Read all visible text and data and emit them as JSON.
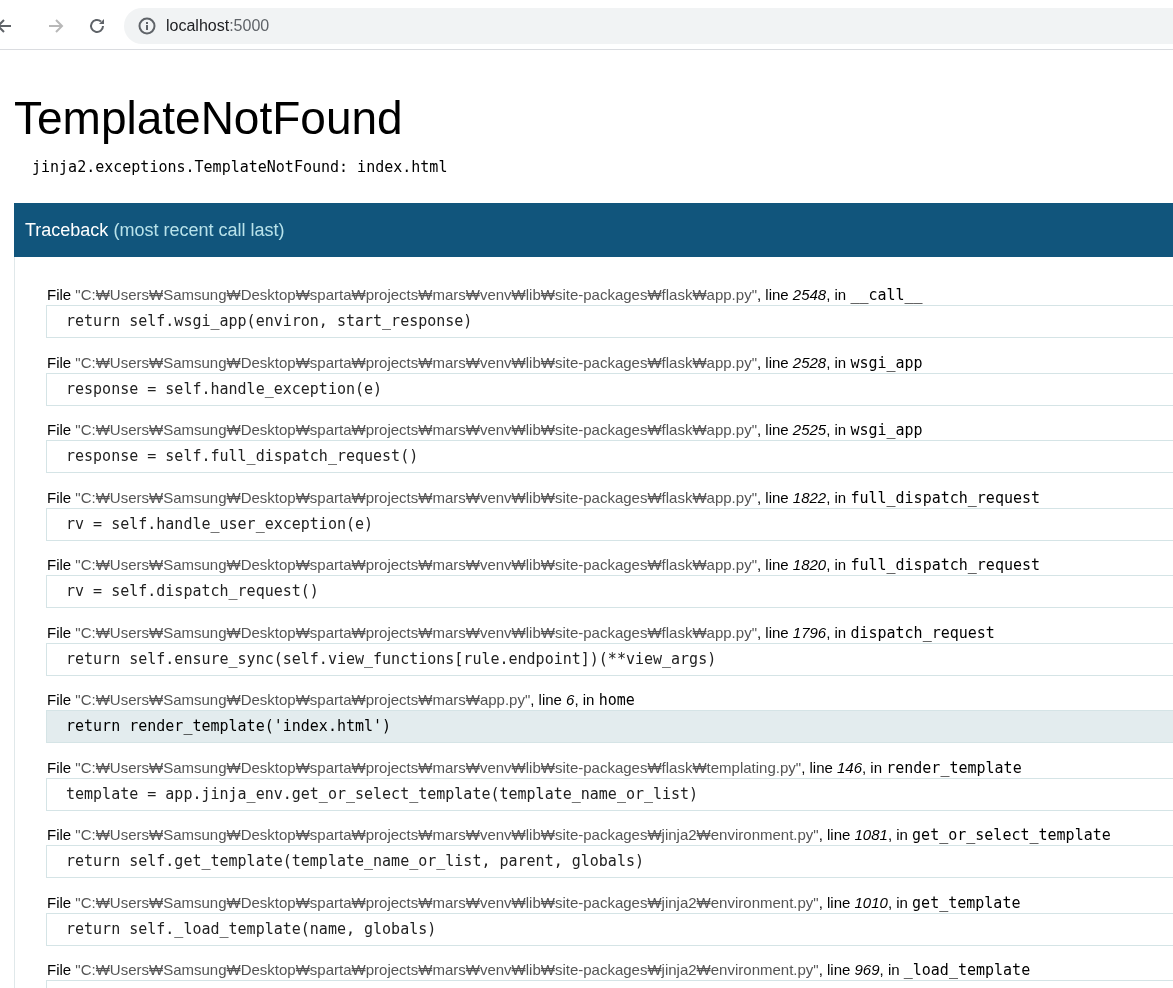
{
  "browser": {
    "url_host": "localhost",
    "url_port": ":5000"
  },
  "title": "TemplateNotFound",
  "exception": "jinja2.exceptions.TemplateNotFound: index.html",
  "traceback": {
    "heading": "Traceback",
    "heading_note": "(most recent call last)",
    "frames": [
      {
        "file_label": "File",
        "file": "\"C:₩Users₩Samsung₩Desktop₩sparta₩projects₩mars₩venv₩lib₩site-packages₩flask₩app.py\"",
        "line_label": ", line",
        "line": "2548",
        "in_label": ", in",
        "function": "__call__",
        "code": "return self.wsgi_app(environ, start_response)",
        "selected": false
      },
      {
        "file_label": "File",
        "file": "\"C:₩Users₩Samsung₩Desktop₩sparta₩projects₩mars₩venv₩lib₩site-packages₩flask₩app.py\"",
        "line_label": ", line",
        "line": "2528",
        "in_label": ", in",
        "function": "wsgi_app",
        "code": "response = self.handle_exception(e)",
        "selected": false
      },
      {
        "file_label": "File",
        "file": "\"C:₩Users₩Samsung₩Desktop₩sparta₩projects₩mars₩venv₩lib₩site-packages₩flask₩app.py\"",
        "line_label": ", line",
        "line": "2525",
        "in_label": ", in",
        "function": "wsgi_app",
        "code": "response = self.full_dispatch_request()",
        "selected": false
      },
      {
        "file_label": "File",
        "file": "\"C:₩Users₩Samsung₩Desktop₩sparta₩projects₩mars₩venv₩lib₩site-packages₩flask₩app.py\"",
        "line_label": ", line",
        "line": "1822",
        "in_label": ", in",
        "function": "full_dispatch_request",
        "code": "rv = self.handle_user_exception(e)",
        "selected": false
      },
      {
        "file_label": "File",
        "file": "\"C:₩Users₩Samsung₩Desktop₩sparta₩projects₩mars₩venv₩lib₩site-packages₩flask₩app.py\"",
        "line_label": ", line",
        "line": "1820",
        "in_label": ", in",
        "function": "full_dispatch_request",
        "code": "rv = self.dispatch_request()",
        "selected": false
      },
      {
        "file_label": "File",
        "file": "\"C:₩Users₩Samsung₩Desktop₩sparta₩projects₩mars₩venv₩lib₩site-packages₩flask₩app.py\"",
        "line_label": ", line",
        "line": "1796",
        "in_label": ", in",
        "function": "dispatch_request",
        "code": "return self.ensure_sync(self.view_functions[rule.endpoint])(**view_args)",
        "selected": false
      },
      {
        "file_label": "File",
        "file": "\"C:₩Users₩Samsung₩Desktop₩sparta₩projects₩mars₩app.py\"",
        "line_label": ", line",
        "line": "6",
        "in_label": ", in",
        "function": "home",
        "code": "return render_template('index.html')",
        "selected": true
      },
      {
        "file_label": "File",
        "file": "\"C:₩Users₩Samsung₩Desktop₩sparta₩projects₩mars₩venv₩lib₩site-packages₩flask₩templating.py\"",
        "line_label": ", line",
        "line": "146",
        "in_label": ", in",
        "function": "render_template",
        "code": "template = app.jinja_env.get_or_select_template(template_name_or_list)",
        "selected": false
      },
      {
        "file_label": "File",
        "file": "\"C:₩Users₩Samsung₩Desktop₩sparta₩projects₩mars₩venv₩lib₩site-packages₩jinja2₩environment.py\"",
        "line_label": ", line",
        "line": "1081",
        "in_label": ", in",
        "function": "get_or_select_template",
        "code": "return self.get_template(template_name_or_list, parent, globals)",
        "selected": false
      },
      {
        "file_label": "File",
        "file": "\"C:₩Users₩Samsung₩Desktop₩sparta₩projects₩mars₩venv₩lib₩site-packages₩jinja2₩environment.py\"",
        "line_label": ", line",
        "line": "1010",
        "in_label": ", in",
        "function": "get_template",
        "code": "return self._load_template(name, globals)",
        "selected": false
      },
      {
        "file_label": "File",
        "file": "\"C:₩Users₩Samsung₩Desktop₩sparta₩projects₩mars₩venv₩lib₩site-packages₩jinja2₩environment.py\"",
        "line_label": ", line",
        "line": "969",
        "in_label": ", in",
        "function": "_load_template",
        "selected": false
      }
    ]
  }
}
